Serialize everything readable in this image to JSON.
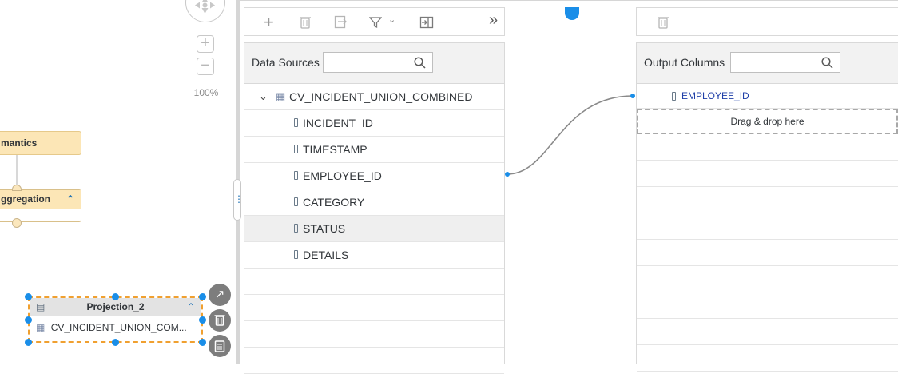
{
  "canvas": {
    "zoom_label": "100%",
    "zoom_in_glyph": "+",
    "zoom_out_glyph": "−",
    "nodes": {
      "semantics_label": "mantics",
      "aggregation_label": "ggregation",
      "projection_title": "Projection_2",
      "projection_source": "CV_INCIDENT_UNION_COM..."
    }
  },
  "toolbar": {
    "add_glyph": "+",
    "more_glyph": "»"
  },
  "data_sources": {
    "label": "Data Sources",
    "search_placeholder": "",
    "source_name": "CV_INCIDENT_UNION_COMBINED",
    "columns": [
      "INCIDENT_ID",
      "TIMESTAMP",
      "EMPLOYEE_ID",
      "CATEGORY",
      "STATUS",
      "DETAILS"
    ],
    "selected_column": "STATUS"
  },
  "output": {
    "label": "Output Columns",
    "search_placeholder": "",
    "columns": [
      "EMPLOYEE_ID"
    ],
    "drop_hint": "Drag & drop here"
  },
  "colors": {
    "accent": "#1a8ee8",
    "node_header": "#fce6b6",
    "link_text": "#1f3fa8",
    "selected_row": "#efefef"
  }
}
